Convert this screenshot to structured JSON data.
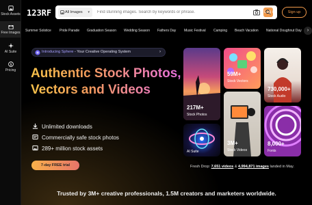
{
  "sidebar": {
    "items": [
      {
        "label": "Stock Assets",
        "icon": "image-icon"
      },
      {
        "label": "Free Images",
        "icon": "gift-icon"
      },
      {
        "label": "AI Suite",
        "icon": "sparkle-icon"
      },
      {
        "label": "Pricing",
        "icon": "dollar-icon"
      }
    ]
  },
  "header": {
    "logo": "123RF",
    "search": {
      "filter_label": "All Images",
      "placeholder": "Find stunning images. Search by keywords or phrase."
    },
    "login_label": "Log in",
    "signup_label": "Sign up"
  },
  "categories": [
    "Summer Solstice",
    "Pride Parade",
    "Graduation Season",
    "Wedding Season",
    "Fathers Day",
    "Music Festival",
    "Camping",
    "Beach Vacation",
    "National Doughnut Day"
  ],
  "hero": {
    "pill_highlight": "Introducing Sphere",
    "pill_rest": " - Your Creative Operating System",
    "headline": "Authentic Stock Photos, Vectors and Videos",
    "features": [
      {
        "text": "Unlimited downloads",
        "icon": "download-icon"
      },
      {
        "text": "Commercially safe stock photos",
        "icon": "license-icon"
      },
      {
        "text": "289+ million stock assets",
        "icon": "gallery-icon"
      }
    ],
    "cta_label": "7-day FREE trial"
  },
  "tiles": [
    {
      "count": "217M+",
      "label": "Stock Photos"
    },
    {
      "count": "59M+",
      "label": "Stock Vectors"
    },
    {
      "count": "730,000+",
      "label": "Stock Audio"
    },
    {
      "count": "",
      "label": "AI Suite"
    },
    {
      "count": "3M+",
      "label": "Stock Videos"
    },
    {
      "count": "8,000+",
      "label": "Fonts"
    }
  ],
  "fresh_drop": {
    "prefix": "Fresh Drop: ",
    "videos": "7,651 videos",
    "amp": " & ",
    "images": "4,994,871 images",
    "suffix": " landed in May."
  },
  "trusted_text": "Trusted by 3M+ creative professionals, 1.5M creators and marketers worldwide."
}
